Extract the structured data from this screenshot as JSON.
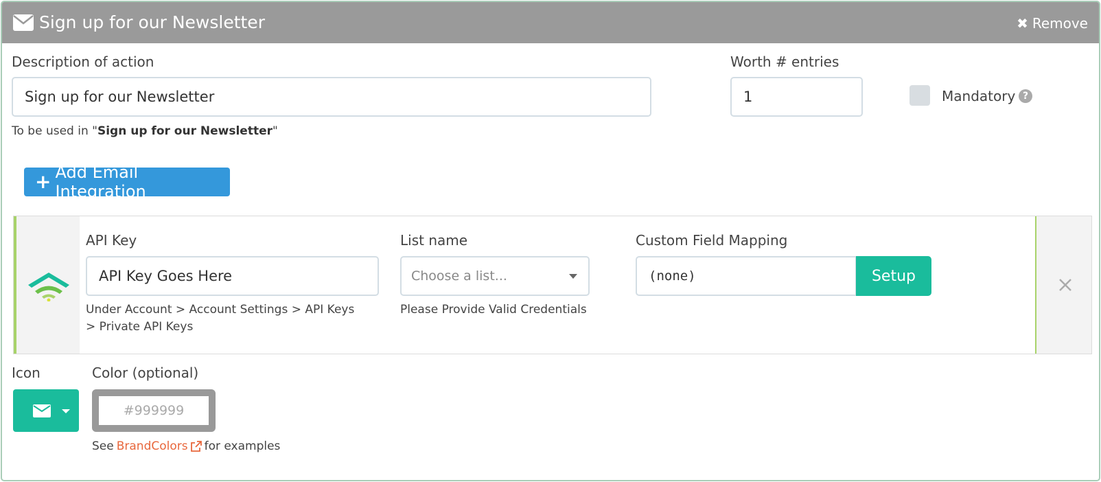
{
  "header": {
    "title": "Sign up for our Newsletter",
    "remove_label": "Remove"
  },
  "description": {
    "label": "Description of action",
    "value": "Sign up for our Newsletter",
    "usage_prefix": "To be used in \"",
    "usage_name": "Sign up for our Newsletter",
    "usage_suffix": "\""
  },
  "worth": {
    "label": "Worth # entries",
    "value": "1"
  },
  "mandatory": {
    "label": "Mandatory",
    "checked": false
  },
  "add_integration": {
    "label": "Add Email Integration"
  },
  "integration": {
    "api_key_label": "API Key",
    "api_key_value": "API Key Goes Here",
    "api_key_help": "Under Account > Account Settings > API Keys > Private API Keys",
    "list_label": "List name",
    "list_placeholder": "Choose a list...",
    "list_help": "Please Provide Valid Credentials",
    "mapping_label": "Custom Field Mapping",
    "mapping_value": "(none)",
    "setup_label": "Setup"
  },
  "icon_section": {
    "label": "Icon",
    "selected_icon": "envelope-icon"
  },
  "color_section": {
    "label": "Color (optional)",
    "placeholder": "#999999",
    "see_prefix": "See",
    "link_text": "BrandColors",
    "see_suffix": "for examples"
  },
  "colors": {
    "header_bg": "#9a9a9a",
    "primary_blue": "#3498db",
    "teal": "#1abc9c",
    "accent_green": "#a8d36a",
    "link_orange": "#e8673c"
  }
}
